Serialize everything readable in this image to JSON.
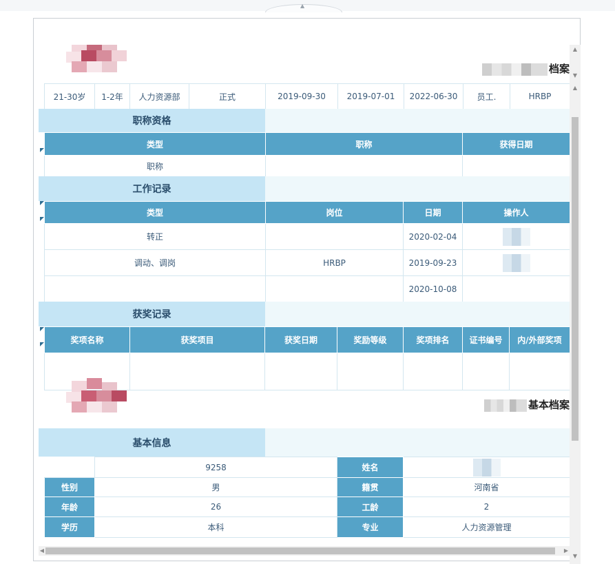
{
  "top_row": [
    "21-30岁",
    "1-2年",
    "人力资源部",
    "正式",
    "2019-09-30",
    "2019-07-01",
    "2022-06-30",
    "员工.",
    "HRBP"
  ],
  "archive1_title_suffix": "档案",
  "qualification": {
    "caption": "职称资格",
    "headers": [
      "类型",
      "职称",
      "获得日期"
    ],
    "rows": [
      [
        "职称",
        "",
        ""
      ]
    ]
  },
  "work": {
    "caption": "工作记录",
    "headers": [
      "类型",
      "岗位",
      "日期",
      "操作人"
    ],
    "rows": [
      [
        "转正",
        "",
        "2020-02-04",
        ""
      ],
      [
        "调动、调岗",
        "HRBP",
        "2019-09-23",
        ""
      ],
      [
        "",
        "",
        "2020-10-08",
        ""
      ]
    ]
  },
  "awards": {
    "caption": "获奖记录",
    "headers": [
      "奖项名称",
      "获奖项目",
      "获奖日期",
      "奖励等级",
      "奖项排名",
      "证书编号",
      "内/外部奖项"
    ]
  },
  "archive2_title_suffix": "基本档案",
  "basic": {
    "caption": "基本信息",
    "id_value": "9258",
    "name_label": "姓名",
    "rows": [
      {
        "l1": "性别",
        "v1": "男",
        "l2": "籍贯",
        "v2": "河南省"
      },
      {
        "l1": "年龄",
        "v1": "26",
        "l2": "工龄",
        "v2": "2"
      },
      {
        "l1": "学历",
        "v1": "本科",
        "l2": "专业",
        "v2": "人力资源管理"
      }
    ]
  },
  "colors": {
    "header": "#55a3c8",
    "caption": "#c5e5f5",
    "caption_fill": "#eef8fb",
    "border": "#d3e6ef"
  },
  "icons": [
    "scroll-up-arrow",
    "scroll-down-arrow",
    "scroll-left-arrow",
    "scroll-right-arrow",
    "collapse-tab-arrow"
  ]
}
